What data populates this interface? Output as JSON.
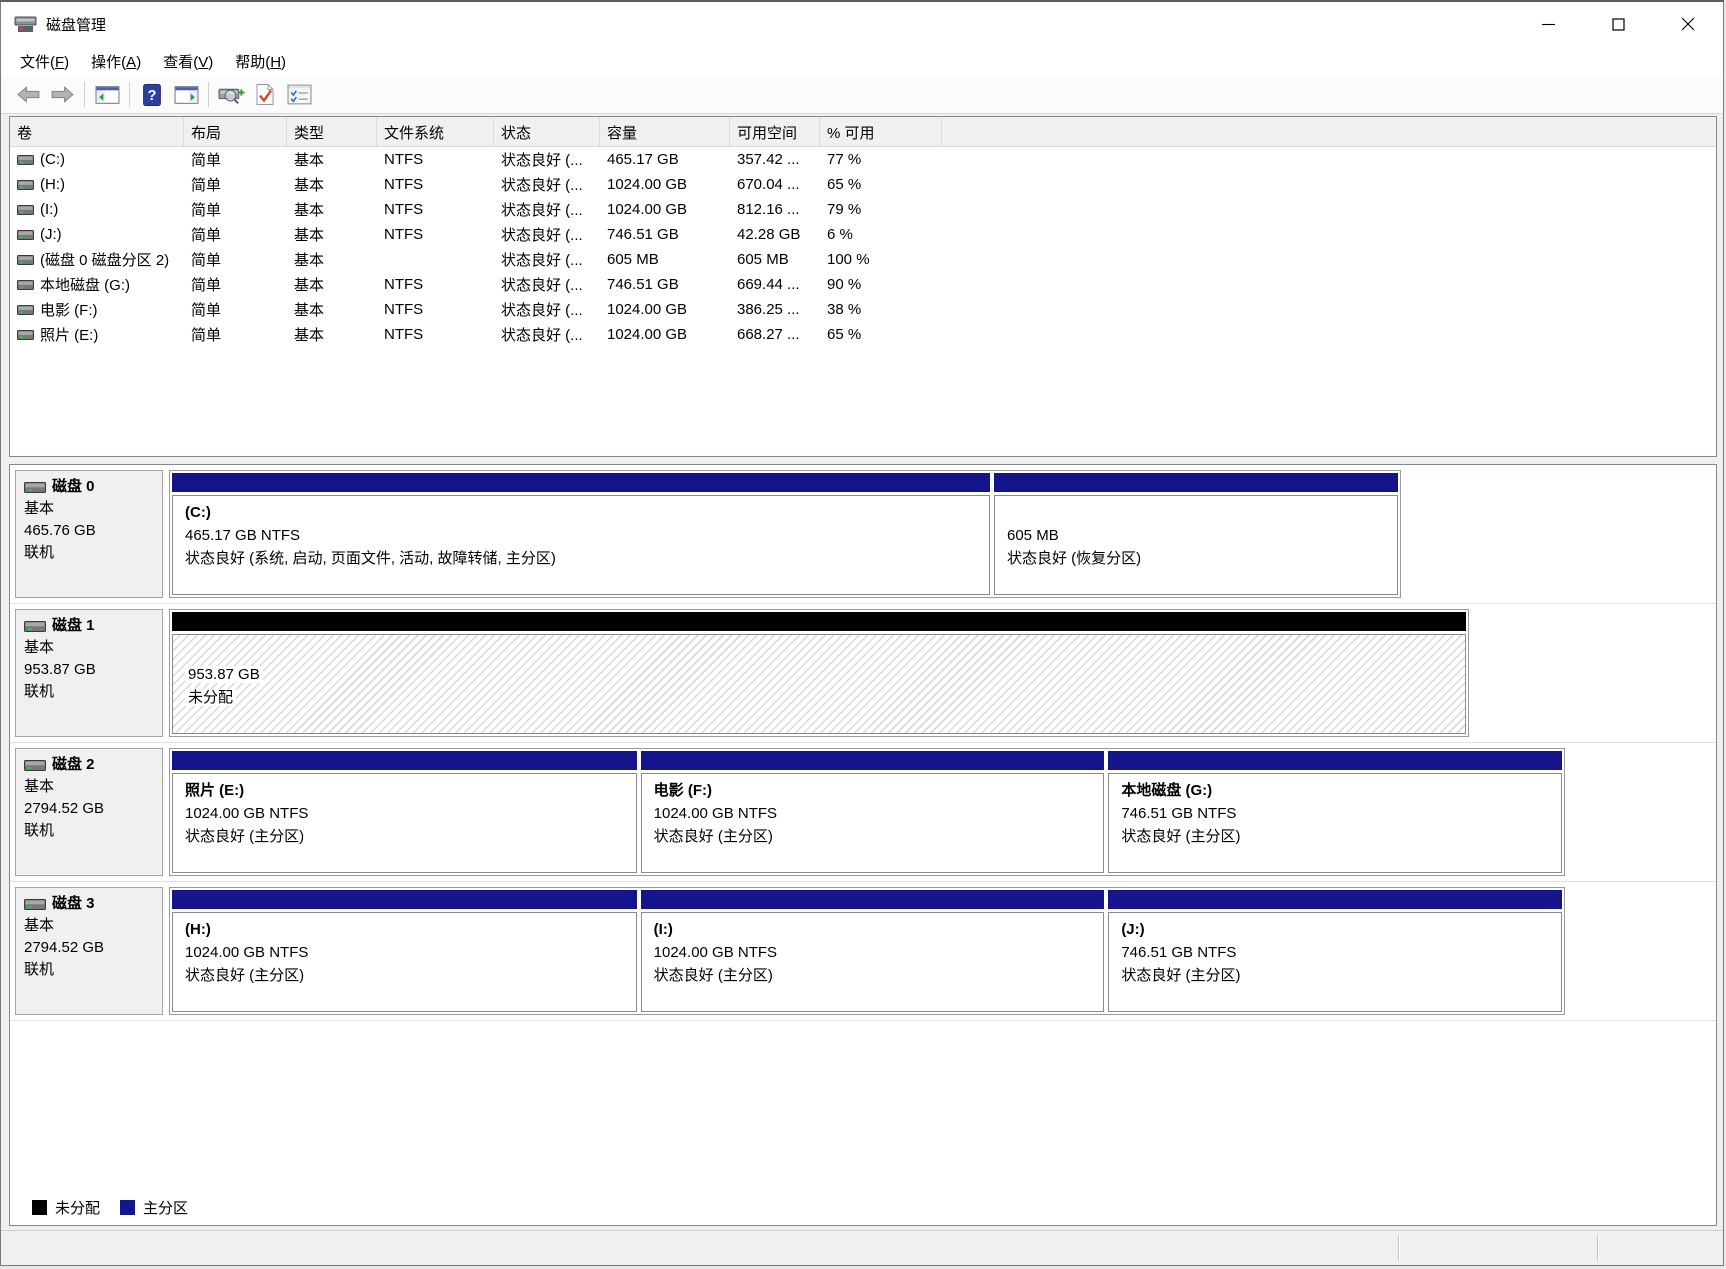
{
  "window": {
    "title": "磁盘管理",
    "controls": [
      "minimize",
      "maximize",
      "close"
    ]
  },
  "menu": {
    "items": [
      "文件(F)",
      "操作(A)",
      "查看(V)",
      "帮助(H)"
    ],
    "names": [
      "file",
      "action",
      "view",
      "help"
    ]
  },
  "toolbar": {
    "icons": [
      "back-arrow",
      "forward-arrow",
      "|",
      "show-console-tree",
      "|",
      "help",
      "show-action-pane",
      "|",
      "rescan-disks",
      "check-document",
      "checklist"
    ]
  },
  "volume_table": {
    "columns": [
      "卷",
      "布局",
      "类型",
      "文件系统",
      "状态",
      "容量",
      "可用空间",
      "% 可用"
    ],
    "rows": [
      {
        "volume": "(C:)",
        "layout": "简单",
        "type": "基本",
        "fs": "NTFS",
        "status": "状态良好 (...",
        "capacity": "465.17 GB",
        "free": "357.42 ...",
        "pct": "77 %"
      },
      {
        "volume": "(H:)",
        "layout": "简单",
        "type": "基本",
        "fs": "NTFS",
        "status": "状态良好 (...",
        "capacity": "1024.00 GB",
        "free": "670.04 ...",
        "pct": "65 %"
      },
      {
        "volume": "(I:)",
        "layout": "简单",
        "type": "基本",
        "fs": "NTFS",
        "status": "状态良好 (...",
        "capacity": "1024.00 GB",
        "free": "812.16 ...",
        "pct": "79 %"
      },
      {
        "volume": "(J:)",
        "layout": "简单",
        "type": "基本",
        "fs": "NTFS",
        "status": "状态良好 (...",
        "capacity": "746.51 GB",
        "free": "42.28 GB",
        "pct": "6 %"
      },
      {
        "volume": "(磁盘 0 磁盘分区 2)",
        "layout": "简单",
        "type": "基本",
        "fs": "",
        "status": "状态良好 (...",
        "capacity": "605 MB",
        "free": "605 MB",
        "pct": "100 %"
      },
      {
        "volume": "本地磁盘 (G:)",
        "layout": "简单",
        "type": "基本",
        "fs": "NTFS",
        "status": "状态良好 (...",
        "capacity": "746.51 GB",
        "free": "669.44 ...",
        "pct": "90 %"
      },
      {
        "volume": "电影 (F:)",
        "layout": "简单",
        "type": "基本",
        "fs": "NTFS",
        "status": "状态良好 (...",
        "capacity": "1024.00 GB",
        "free": "386.25 ...",
        "pct": "38 %"
      },
      {
        "volume": "照片 (E:)",
        "layout": "简单",
        "type": "基本",
        "fs": "NTFS",
        "status": "状态良好 (...",
        "capacity": "1024.00 GB",
        "free": "668.27 ...",
        "pct": "65 %"
      }
    ]
  },
  "disks": [
    {
      "label": "磁盘 0",
      "type": "基本",
      "size": "465.76 GB",
      "state": "联机",
      "strip_width": 1232,
      "partitions": [
        {
          "name": "(C:)",
          "size": "465.17 GB NTFS",
          "status": "状态良好 (系统, 启动, 页面文件, 活动, 故障转储, 主分区)",
          "kind": "primary",
          "weight": 818
        },
        {
          "name": "",
          "size": "605 MB",
          "status": "状态良好 (恢复分区)",
          "kind": "primary",
          "weight": 404
        }
      ]
    },
    {
      "label": "磁盘 1",
      "type": "基本",
      "size": "953.87 GB",
      "state": "联机",
      "strip_width": 1300,
      "partitions": [
        {
          "name": "",
          "size": "953.87 GB",
          "status": "未分配",
          "kind": "unallocated",
          "weight": 1
        }
      ]
    },
    {
      "label": "磁盘 2",
      "type": "基本",
      "size": "2794.52 GB",
      "state": "联机",
      "strip_width": 1396,
      "partitions": [
        {
          "name": "照片 (E:)",
          "size": "1024.00 GB NTFS",
          "status": "状态良好 (主分区)",
          "kind": "primary",
          "weight": 466
        },
        {
          "name": "电影 (F:)",
          "size": "1024.00 GB NTFS",
          "status": "状态良好 (主分区)",
          "kind": "primary",
          "weight": 465
        },
        {
          "name": "本地磁盘 (G:)",
          "size": "746.51 GB NTFS",
          "status": "状态良好 (主分区)",
          "kind": "primary",
          "weight": 455
        }
      ]
    },
    {
      "label": "磁盘 3",
      "type": "基本",
      "size": "2794.52 GB",
      "state": "联机",
      "strip_width": 1396,
      "partitions": [
        {
          "name": "(H:)",
          "size": "1024.00 GB NTFS",
          "status": "状态良好 (主分区)",
          "kind": "primary",
          "weight": 466
        },
        {
          "name": "(I:)",
          "size": "1024.00 GB NTFS",
          "status": "状态良好 (主分区)",
          "kind": "primary",
          "weight": 465
        },
        {
          "name": "(J:)",
          "size": "746.51 GB NTFS",
          "status": "状态良好 (主分区)",
          "kind": "primary",
          "weight": 455
        }
      ]
    }
  ],
  "legend": {
    "items": [
      {
        "label": "未分配",
        "color": "#000000"
      },
      {
        "label": "主分区",
        "color": "#14148c"
      }
    ]
  },
  "colors": {
    "primary_partition": "#14148c",
    "unallocated": "#000000",
    "header_bg": "#f0f0f0",
    "panel_border": "#828790"
  }
}
